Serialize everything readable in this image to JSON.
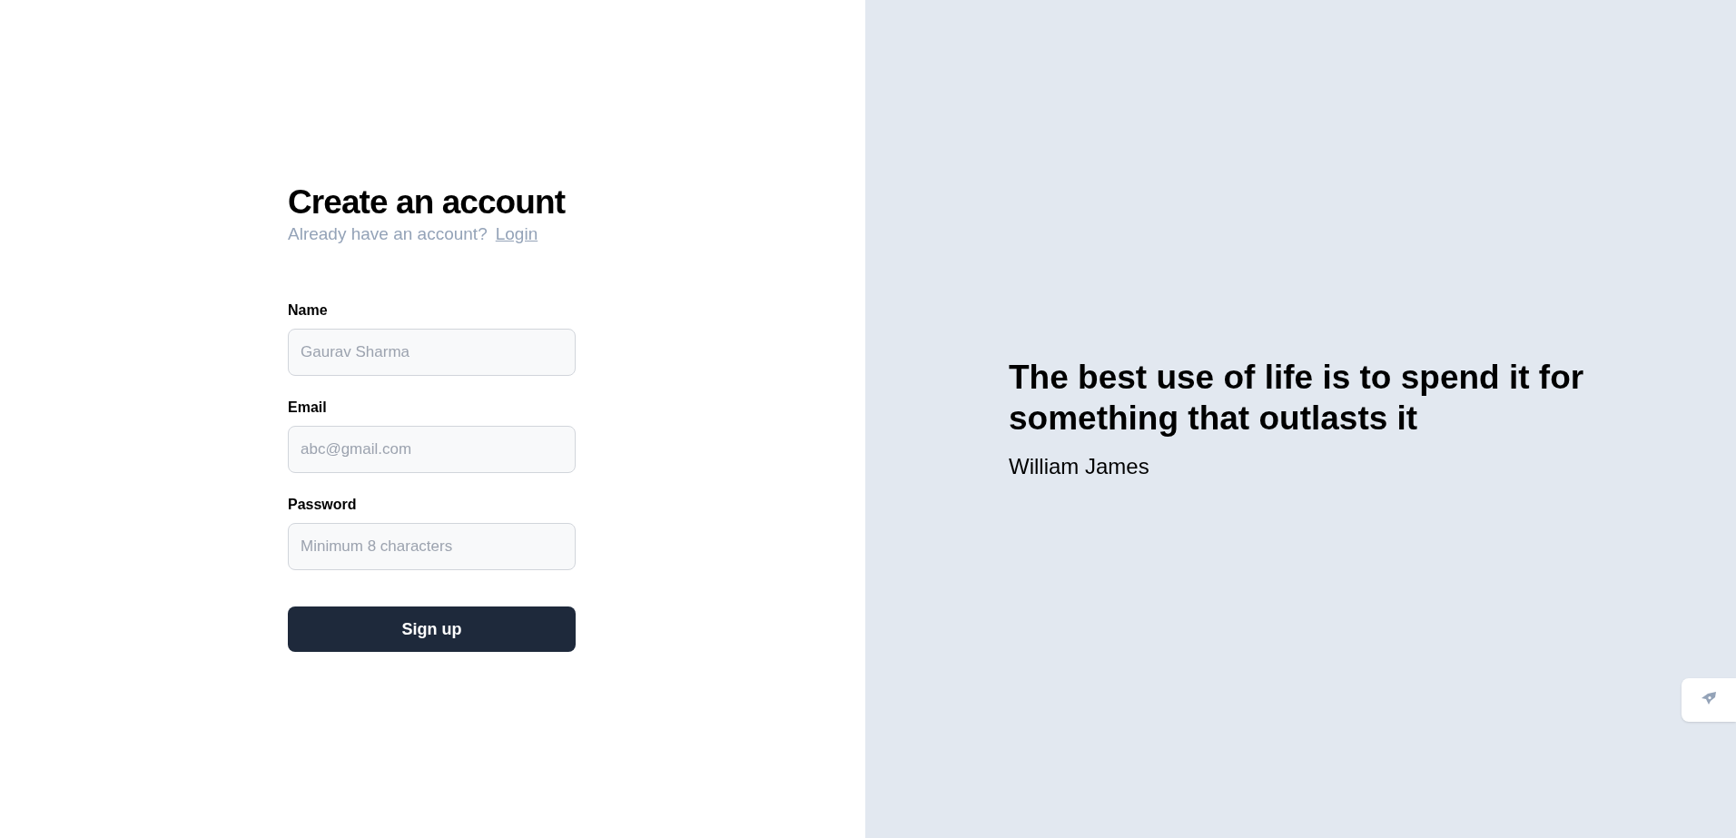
{
  "form": {
    "title": "Create an account",
    "subtitle": "Already have an account?",
    "login_link": "Login",
    "fields": [
      {
        "label": "Name",
        "placeholder": "Gaurav Sharma"
      },
      {
        "label": "Email",
        "placeholder": "abc@gmail.com"
      },
      {
        "label": "Password",
        "placeholder": "Minimum 8 characters"
      }
    ],
    "submit": "Sign up"
  },
  "quote": {
    "text": "The best use of life is to spend it for something that outlasts it",
    "author": "William James"
  }
}
